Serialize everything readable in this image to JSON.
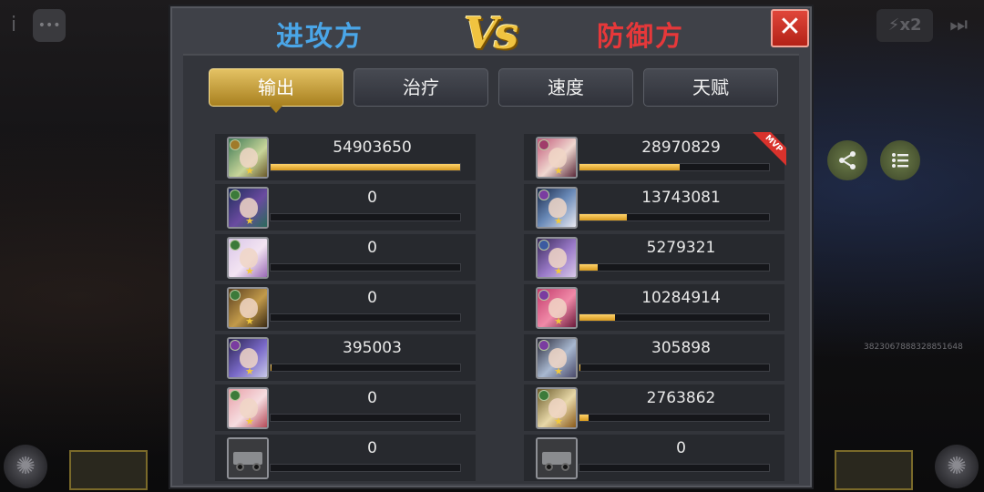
{
  "hud": {
    "info_glyph": "i",
    "chat_glyph": "•••",
    "speed_label": "x2",
    "skip_glyph": "⏭",
    "bg_id": "3823067888328851648"
  },
  "header": {
    "attacker_title": "进攻方",
    "vs_label": "Vs",
    "defender_title": "防御方",
    "close_glyph": "✕"
  },
  "tabs": [
    {
      "label": "输出",
      "active": true
    },
    {
      "label": "治疗",
      "active": false
    },
    {
      "label": "速度",
      "active": false
    },
    {
      "label": "天赋",
      "active": false
    }
  ],
  "attackers": [
    {
      "value": "54903650",
      "share": 1.0
    },
    {
      "value": "0",
      "share": 0
    },
    {
      "value": "0",
      "share": 0
    },
    {
      "value": "0",
      "share": 0
    },
    {
      "value": "395003",
      "share": 0.007
    },
    {
      "value": "0",
      "share": 0
    },
    {
      "value": "0",
      "share": 0
    }
  ],
  "defenders": [
    {
      "value": "28970829",
      "share": 0.527,
      "mvp": true
    },
    {
      "value": "13743081",
      "share": 0.25
    },
    {
      "value": "5279321",
      "share": 0.096
    },
    {
      "value": "10284914",
      "share": 0.187
    },
    {
      "value": "305898",
      "share": 0.006
    },
    {
      "value": "2763862",
      "share": 0.05
    },
    {
      "value": "0",
      "share": 0
    }
  ],
  "mvp_label": "MVP",
  "colors": {
    "attacker": "#4aa6e8",
    "defender": "#e6383a",
    "bar": "#e8b53a",
    "vs": "#f0c340"
  }
}
